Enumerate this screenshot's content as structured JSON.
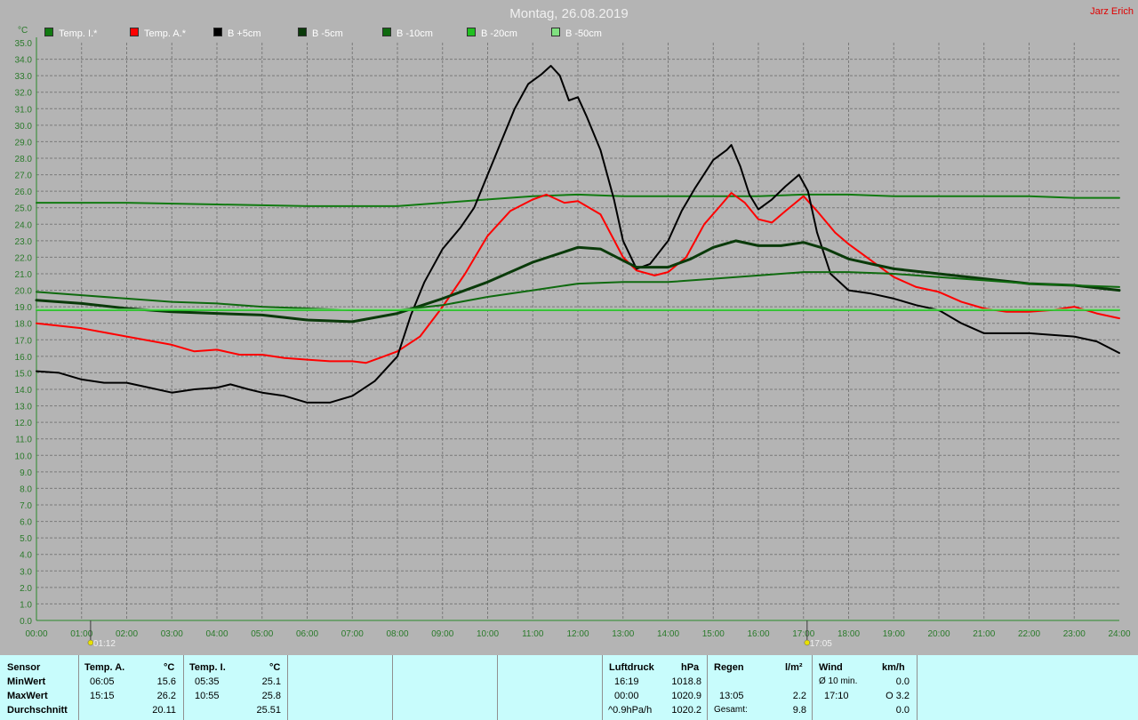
{
  "header": {
    "title": "Montag, 26.08.2019",
    "author": "Jarz Erich"
  },
  "colors": {
    "background": "#b4b4b4",
    "grid": "#7a7a7a",
    "axis_text": "#2a7a2a",
    "panel": "#c8fcfc",
    "title": "#f0f0f0",
    "author": "#e00000"
  },
  "legend": [
    {
      "label": "Temp. I.*",
      "color": "#117a11"
    },
    {
      "label": "Temp. A.*",
      "color": "#ff0000"
    },
    {
      "label": "B +5cm",
      "color": "#000000"
    },
    {
      "label": "B -5cm",
      "color": "#0a3a0a"
    },
    {
      "label": "B -10cm",
      "color": "#0f6a0f"
    },
    {
      "label": "B -20cm",
      "color": "#20c020"
    },
    {
      "label": "B -50cm",
      "color": "#80e080"
    }
  ],
  "chart_data": {
    "type": "line",
    "ylabel": "°C",
    "ylim": [
      0,
      35
    ],
    "ytick_step": 1,
    "xlim": [
      0,
      24
    ],
    "x_ticks": [
      "00:00",
      "01:00",
      "02:00",
      "03:00",
      "04:00",
      "05:00",
      "06:00",
      "07:00",
      "08:00",
      "09:00",
      "10:00",
      "11:00",
      "12:00",
      "13:00",
      "14:00",
      "15:00",
      "16:00",
      "17:00",
      "18:00",
      "19:00",
      "20:00",
      "21:00",
      "22:00",
      "23:00",
      "24:00"
    ],
    "sun_markers": [
      {
        "x": 1.2,
        "label": "01:12"
      },
      {
        "x": 17.08,
        "label": "17:05"
      }
    ],
    "grid": true,
    "series": [
      {
        "name": "Temp. I.*",
        "color": "#117a11",
        "width": 2,
        "points": [
          [
            0,
            25.3
          ],
          [
            2,
            25.3
          ],
          [
            4,
            25.2
          ],
          [
            6,
            25.1
          ],
          [
            8,
            25.1
          ],
          [
            9,
            25.3
          ],
          [
            10,
            25.5
          ],
          [
            11,
            25.7
          ],
          [
            12,
            25.8
          ],
          [
            13,
            25.7
          ],
          [
            14,
            25.7
          ],
          [
            15,
            25.7
          ],
          [
            16,
            25.7
          ],
          [
            17,
            25.8
          ],
          [
            18,
            25.8
          ],
          [
            19,
            25.7
          ],
          [
            20,
            25.7
          ],
          [
            21,
            25.7
          ],
          [
            22,
            25.7
          ],
          [
            23,
            25.6
          ],
          [
            24,
            25.6
          ]
        ]
      },
      {
        "name": "Temp. A.*",
        "color": "#ff0000",
        "width": 2,
        "points": [
          [
            0,
            18.0
          ],
          [
            1,
            17.7
          ],
          [
            2,
            17.2
          ],
          [
            3,
            16.7
          ],
          [
            3.5,
            16.3
          ],
          [
            4,
            16.4
          ],
          [
            4.5,
            16.1
          ],
          [
            5,
            16.1
          ],
          [
            5.5,
            15.9
          ],
          [
            6,
            15.8
          ],
          [
            6.5,
            15.7
          ],
          [
            7,
            15.7
          ],
          [
            7.3,
            15.6
          ],
          [
            7.7,
            16.0
          ],
          [
            8,
            16.3
          ],
          [
            8.5,
            17.2
          ],
          [
            9,
            19.0
          ],
          [
            9.5,
            21.0
          ],
          [
            10,
            23.3
          ],
          [
            10.5,
            24.8
          ],
          [
            11,
            25.5
          ],
          [
            11.3,
            25.8
          ],
          [
            11.7,
            25.3
          ],
          [
            12,
            25.4
          ],
          [
            12.5,
            24.6
          ],
          [
            13,
            22.0
          ],
          [
            13.3,
            21.2
          ],
          [
            13.7,
            20.9
          ],
          [
            14,
            21.1
          ],
          [
            14.4,
            22.0
          ],
          [
            14.8,
            24.0
          ],
          [
            15.15,
            25.1
          ],
          [
            15.4,
            25.9
          ],
          [
            15.7,
            25.3
          ],
          [
            16,
            24.3
          ],
          [
            16.3,
            24.1
          ],
          [
            16.6,
            24.8
          ],
          [
            17,
            25.7
          ],
          [
            17.3,
            24.8
          ],
          [
            17.7,
            23.5
          ],
          [
            18,
            22.8
          ],
          [
            18.5,
            21.8
          ],
          [
            19,
            20.8
          ],
          [
            19.5,
            20.2
          ],
          [
            20,
            19.9
          ],
          [
            20.5,
            19.3
          ],
          [
            21,
            18.9
          ],
          [
            21.5,
            18.7
          ],
          [
            22,
            18.7
          ],
          [
            22.5,
            18.8
          ],
          [
            23,
            19.0
          ],
          [
            23.5,
            18.6
          ],
          [
            24,
            18.3
          ]
        ]
      },
      {
        "name": "B +5cm",
        "color": "#000000",
        "width": 2,
        "points": [
          [
            0,
            15.1
          ],
          [
            0.5,
            15.0
          ],
          [
            1,
            14.6
          ],
          [
            1.5,
            14.4
          ],
          [
            2,
            14.4
          ],
          [
            2.5,
            14.1
          ],
          [
            3,
            13.8
          ],
          [
            3.5,
            14.0
          ],
          [
            4,
            14.1
          ],
          [
            4.3,
            14.3
          ],
          [
            4.7,
            14.0
          ],
          [
            5,
            13.8
          ],
          [
            5.5,
            13.6
          ],
          [
            6,
            13.2
          ],
          [
            6.5,
            13.2
          ],
          [
            7,
            13.6
          ],
          [
            7.5,
            14.5
          ],
          [
            8,
            16.0
          ],
          [
            8.3,
            18.5
          ],
          [
            8.6,
            20.5
          ],
          [
            9,
            22.5
          ],
          [
            9.4,
            23.8
          ],
          [
            9.7,
            25.0
          ],
          [
            10,
            27.0
          ],
          [
            10.3,
            29.0
          ],
          [
            10.6,
            31.0
          ],
          [
            10.9,
            32.5
          ],
          [
            11.2,
            33.1
          ],
          [
            11.4,
            33.6
          ],
          [
            11.6,
            33.0
          ],
          [
            11.8,
            31.5
          ],
          [
            12,
            31.7
          ],
          [
            12.2,
            30.5
          ],
          [
            12.5,
            28.5
          ],
          [
            12.8,
            25.5
          ],
          [
            13,
            23.0
          ],
          [
            13.3,
            21.3
          ],
          [
            13.6,
            21.6
          ],
          [
            14,
            23.0
          ],
          [
            14.3,
            24.8
          ],
          [
            14.6,
            26.2
          ],
          [
            15,
            27.9
          ],
          [
            15.3,
            28.5
          ],
          [
            15.4,
            28.8
          ],
          [
            15.6,
            27.5
          ],
          [
            15.8,
            25.8
          ],
          [
            16,
            24.9
          ],
          [
            16.3,
            25.5
          ],
          [
            16.6,
            26.3
          ],
          [
            16.9,
            27.0
          ],
          [
            17.1,
            26.0
          ],
          [
            17.3,
            23.5
          ],
          [
            17.6,
            21.0
          ],
          [
            18,
            20.0
          ],
          [
            18.5,
            19.8
          ],
          [
            19,
            19.5
          ],
          [
            19.5,
            19.1
          ],
          [
            20,
            18.8
          ],
          [
            20.5,
            18.0
          ],
          [
            21,
            17.4
          ],
          [
            21.5,
            17.4
          ],
          [
            22,
            17.4
          ],
          [
            22.5,
            17.3
          ],
          [
            23,
            17.2
          ],
          [
            23.5,
            16.9
          ],
          [
            24,
            16.2
          ]
        ]
      },
      {
        "name": "B -5cm",
        "color": "#0a3a0a",
        "width": 3,
        "points": [
          [
            0,
            19.4
          ],
          [
            1,
            19.2
          ],
          [
            2,
            18.9
          ],
          [
            3,
            18.7
          ],
          [
            4,
            18.6
          ],
          [
            5,
            18.5
          ],
          [
            6,
            18.2
          ],
          [
            7,
            18.1
          ],
          [
            8,
            18.6
          ],
          [
            9,
            19.5
          ],
          [
            10,
            20.5
          ],
          [
            11,
            21.7
          ],
          [
            12,
            22.6
          ],
          [
            12.5,
            22.5
          ],
          [
            13,
            21.8
          ],
          [
            13.3,
            21.4
          ],
          [
            14,
            21.4
          ],
          [
            14.5,
            21.9
          ],
          [
            15,
            22.6
          ],
          [
            15.5,
            23.0
          ],
          [
            16,
            22.7
          ],
          [
            16.5,
            22.7
          ],
          [
            17,
            22.9
          ],
          [
            17.5,
            22.5
          ],
          [
            18,
            21.9
          ],
          [
            18.5,
            21.6
          ],
          [
            19,
            21.3
          ],
          [
            20,
            21.0
          ],
          [
            21,
            20.7
          ],
          [
            22,
            20.4
          ],
          [
            23,
            20.3
          ],
          [
            24,
            20.0
          ]
        ]
      },
      {
        "name": "B -10cm",
        "color": "#0f6a0f",
        "width": 2,
        "points": [
          [
            0,
            19.9
          ],
          [
            1,
            19.7
          ],
          [
            2,
            19.5
          ],
          [
            3,
            19.3
          ],
          [
            4,
            19.2
          ],
          [
            5,
            19.0
          ],
          [
            6,
            18.9
          ],
          [
            7,
            18.8
          ],
          [
            8,
            18.8
          ],
          [
            9,
            19.1
          ],
          [
            10,
            19.6
          ],
          [
            11,
            20.0
          ],
          [
            12,
            20.4
          ],
          [
            13,
            20.5
          ],
          [
            14,
            20.5
          ],
          [
            15,
            20.7
          ],
          [
            16,
            20.9
          ],
          [
            17,
            21.1
          ],
          [
            18,
            21.1
          ],
          [
            19,
            21.0
          ],
          [
            20,
            20.8
          ],
          [
            21,
            20.6
          ],
          [
            22,
            20.4
          ],
          [
            23,
            20.3
          ],
          [
            24,
            20.2
          ]
        ]
      },
      {
        "name": "B -20cm",
        "color": "#20c020",
        "width": 2,
        "points": [
          [
            0,
            18.8
          ],
          [
            4,
            18.8
          ],
          [
            8,
            18.8
          ],
          [
            12,
            18.8
          ],
          [
            16,
            18.8
          ],
          [
            20,
            18.8
          ],
          [
            24,
            18.8
          ]
        ]
      },
      {
        "name": "B -50cm",
        "color": "#80e080",
        "width": 1,
        "points": [
          [
            0,
            18.85
          ],
          [
            24,
            18.85
          ]
        ]
      }
    ]
  },
  "stats": {
    "sensor_header": "Sensor",
    "rows": [
      "MinWert",
      "MaxWert",
      "Durchschnitt"
    ],
    "temp_a": {
      "label": "Temp. A.",
      "unit": "°C",
      "min_time": "06:05",
      "min_val": "15.6",
      "max_time": "15:15",
      "max_val": "26.2",
      "avg": "20.11"
    },
    "temp_i": {
      "label": "Temp. I.",
      "unit": "°C",
      "min_time": "05:35",
      "min_val": "25.1",
      "max_time": "10:55",
      "max_val": "25.8",
      "avg": "25.51"
    },
    "pressure": {
      "label": "Luftdruck",
      "unit": "hPa",
      "r1_time": "16:19",
      "r1_val": "1018.8",
      "r2_time": "00:00",
      "r2_val": "1020.9",
      "r3_label": "^0.9hPa/h",
      "r3_val": "1020.2"
    },
    "rain": {
      "label": "Regen",
      "unit": "l/m²",
      "r2_time": "13:05",
      "r2_val": "2.2",
      "r3_label": "Gesamt:",
      "r3_val": "9.8"
    },
    "wind": {
      "label": "Wind",
      "unit": "km/h",
      "r1_label": "Ø 10 min.",
      "r1_val": "0.0",
      "r2_time": "17:10",
      "r2_val": "O 3.2",
      "r3_val": "0.0"
    }
  }
}
